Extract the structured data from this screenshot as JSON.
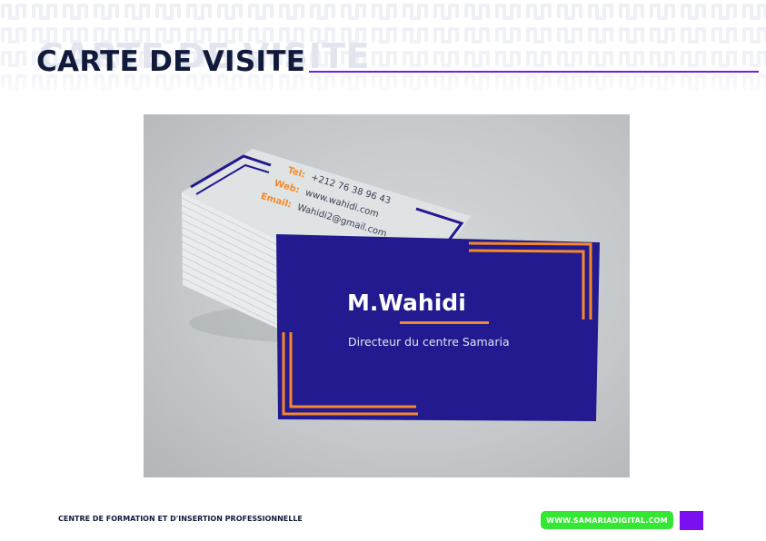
{
  "header": {
    "title": "CARTE DE VISITE"
  },
  "business_card": {
    "front": {
      "name": "M.Wahidi",
      "role": "Directeur du centre Samaria"
    },
    "back": {
      "lines": [
        {
          "label": "Tel:",
          "value": "+212 76 38 96 43"
        },
        {
          "label": "Web:",
          "value": "www.wahidi.com"
        },
        {
          "label": "Email:",
          "value": "Wahidi2@gmail.com"
        }
      ]
    }
  },
  "footer": {
    "organization": "CENTRE DE FORMATION ET D'INSERTION PROFESSIONNELLE",
    "website": "WWW.SAMARIADIGITAL.COM"
  },
  "colors": {
    "title": "#111a3a",
    "accent_purple": "#6a22e8",
    "card_blue": "#22178f",
    "card_orange": "#f5892b",
    "footer_green": "#35e634"
  }
}
